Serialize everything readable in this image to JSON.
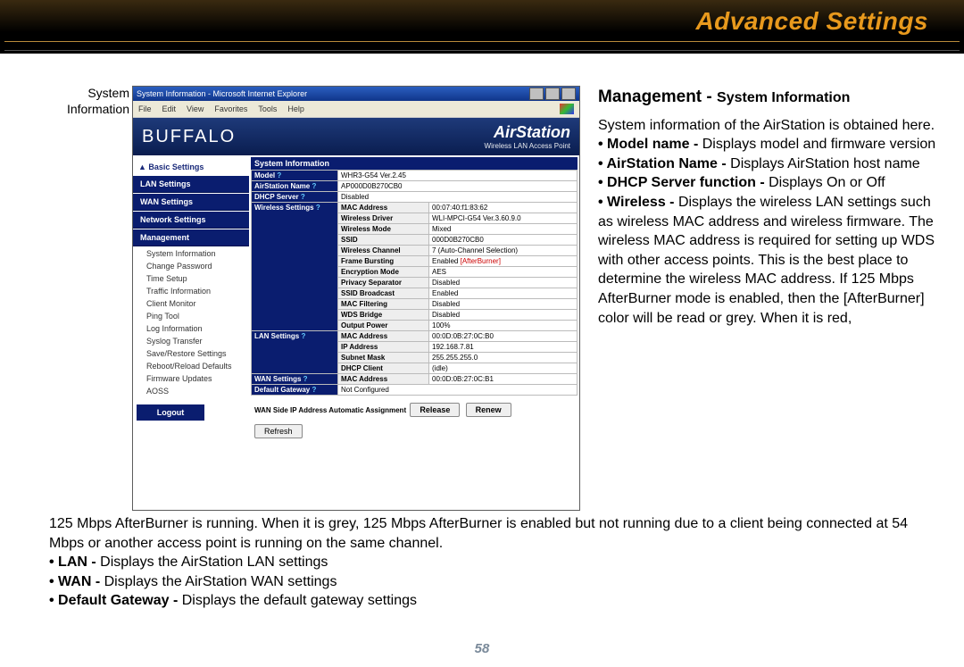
{
  "page_title": "Advanced Settings",
  "page_number": "58",
  "crumb": "System Information",
  "ie": {
    "window_title": "System Information - Microsoft Internet Explorer",
    "menu": [
      "File",
      "Edit",
      "View",
      "Favorites",
      "Tools",
      "Help"
    ]
  },
  "banner": {
    "brand": "BUFFALO",
    "product": "AirStation",
    "subtitle": "Wireless LAN Access Point"
  },
  "sidebar": {
    "head": "▲ Basic Settings",
    "buttons": [
      "LAN Settings",
      "WAN Settings",
      "Network Settings",
      "Management"
    ],
    "subs": [
      "System Information",
      "Change Password",
      "Time Setup",
      "Traffic Information",
      "Client Monitor",
      "Ping Tool",
      "Log Information",
      "Syslog Transfer",
      "Save/Restore Settings",
      "Reboot/Reload Defaults",
      "Firmware Updates",
      "AOSS"
    ],
    "logout": "Logout"
  },
  "sysinfo": {
    "section": "System Information",
    "model_label": "Model",
    "model_value": "WHR3-G54 Ver.2.45",
    "name_label": "AirStation Name",
    "name_value": "AP000D0B270CB0",
    "dhcp_label": "DHCP Server",
    "dhcp_value": "Disabled",
    "wireless_label": "Wireless Settings",
    "wireless_rows": [
      {
        "k": "MAC Address",
        "v": "00:07:40:f1:83:62"
      },
      {
        "k": "Wireless Driver",
        "v": "WLI-MPCI-G54 Ver.3.60.9.0"
      },
      {
        "k": "Wireless Mode",
        "v": "Mixed"
      },
      {
        "k": "SSID",
        "v": "000D0B270CB0"
      },
      {
        "k": "Wireless Channel",
        "v": "7 (Auto-Channel Selection)"
      },
      {
        "k": "Frame Bursting",
        "v": "Enabled [AfterBurner]",
        "red": true
      },
      {
        "k": "Encryption Mode",
        "v": "AES"
      },
      {
        "k": "Privacy Separator",
        "v": "Disabled"
      },
      {
        "k": "SSID Broadcast",
        "v": "Enabled"
      },
      {
        "k": "MAC Filtering",
        "v": "Disabled"
      },
      {
        "k": "WDS Bridge",
        "v": "Disabled"
      },
      {
        "k": "Output Power",
        "v": "100%"
      }
    ],
    "lan_label": "LAN Settings",
    "lan_rows": [
      {
        "k": "MAC Address",
        "v": "00:0D:0B:27:0C:B0"
      },
      {
        "k": "IP Address",
        "v": "192.168.7.81"
      },
      {
        "k": "Subnet Mask",
        "v": "255.255.255.0"
      },
      {
        "k": "DHCP Client",
        "v": "(idle)"
      }
    ],
    "wan_label": "WAN Settings",
    "wan_rows": [
      {
        "k": "MAC Address",
        "v": "00:0D:0B:27:0C:B1"
      }
    ],
    "gw_label": "Default Gateway",
    "gw_value": "Not Configured",
    "wan_auto": "WAN Side IP Address Automatic Assignment",
    "btn_release": "Release",
    "btn_renew": "Renew",
    "btn_refresh": "Refresh"
  },
  "right": {
    "heading_main": "Management - ",
    "heading_sub": "System Information",
    "intro": "System information of the AirStation is obtained here.",
    "b1_bold": "• Model name - ",
    "b1_text": "Displays model and firmware version",
    "b2_bold": "• AirStation Name - ",
    "b2_text": "Displays AirStation host name",
    "b3_bold": "• DHCP Server function - ",
    "b3_text": "Displays On or Off",
    "b4_bold": "• Wireless - ",
    "b4_text": "Displays the wireless LAN settings such as wireless MAC address and wireless firmware.  The wireless MAC address is required for setting up WDS with other access points.  This is the best place to determine the wireless MAC address.  If 125 Mbps AfterBurner mode is enabled, then the [AfterBurner] color will be read or grey.  When it is red,"
  },
  "lower": {
    "cont": "125 Mbps AfterBurner is running.  When it is grey, 125 Mbps AfterBurner is enabled but not running due to a client being connected at 54 Mbps or another access point is running on the same channel.",
    "l1_bold": "• LAN - ",
    "l1_text": "Displays the AirStation LAN settings",
    "l2_bold": "• WAN - ",
    "l2_text": "Displays the AirStation WAN settings",
    "l3_bold": "• Default Gateway - ",
    "l3_text": "Displays the default gateway settings"
  }
}
